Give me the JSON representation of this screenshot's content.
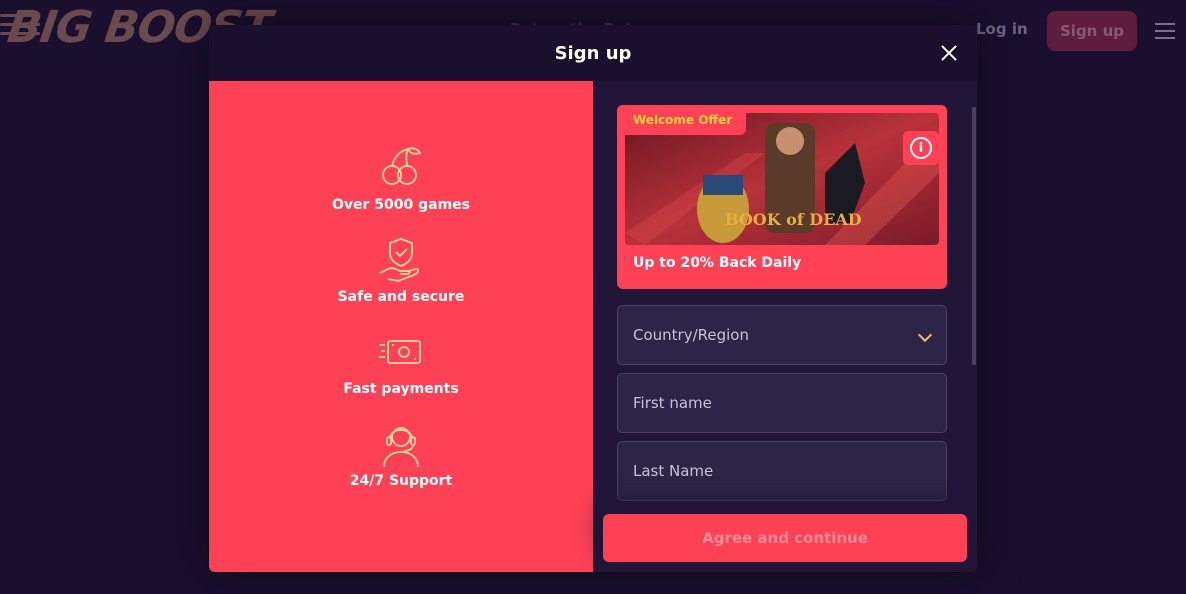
{
  "background": {
    "logo_text": "BIG BOOST",
    "nav_text": "Bet on the Pet",
    "login_label": "Log in",
    "signup_label": "Sign up"
  },
  "modal": {
    "title": "Sign up",
    "features": [
      {
        "icon": "cherries-icon",
        "label": "Over 5000 games"
      },
      {
        "icon": "shield-hand-icon",
        "label": "Safe and secure"
      },
      {
        "icon": "money-icon",
        "label": "Fast payments"
      },
      {
        "icon": "headset-icon",
        "label": "24/7 Support"
      }
    ],
    "promo": {
      "badge": "Welcome Offer",
      "text": "Up to 20% Back Daily",
      "image_alt": "Book of Dead"
    },
    "form": {
      "country_placeholder": "Country/Region",
      "first_name_placeholder": "First name",
      "last_name_placeholder": "Last Name",
      "submit_label": "Agree and continue"
    }
  },
  "colors": {
    "brand_red": "#ff4155",
    "dark_bg": "#1a0f2e",
    "accent_gold": "#ffd23a"
  }
}
